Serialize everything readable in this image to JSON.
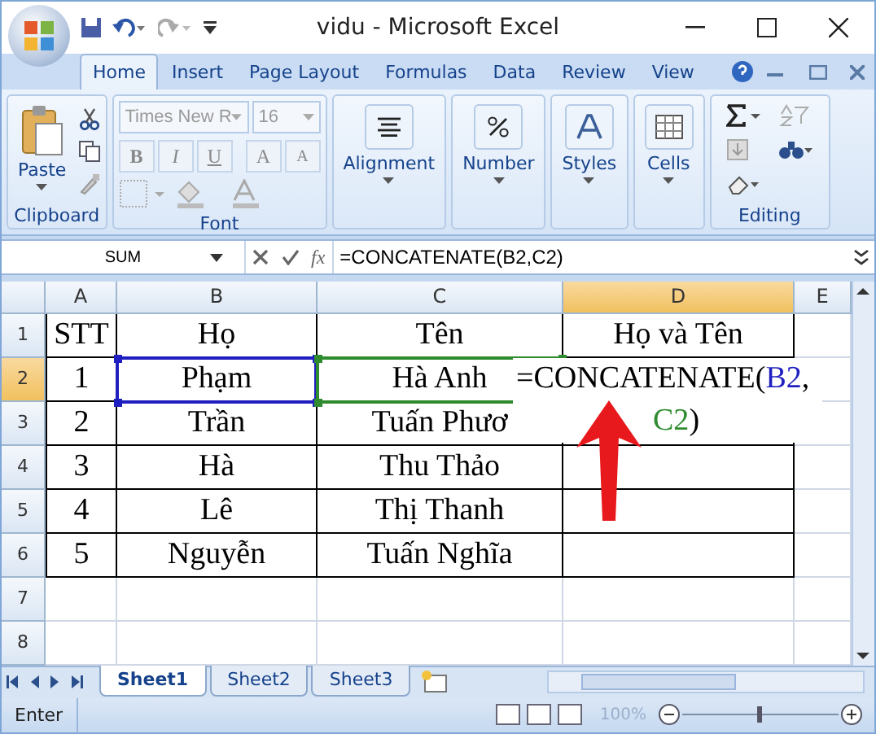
{
  "window": {
    "title": "vidu - Microsoft Excel"
  },
  "tabs": [
    {
      "label": "Home",
      "selected": true
    },
    {
      "label": "Insert",
      "selected": false
    },
    {
      "label": "Page Layout",
      "selected": false
    },
    {
      "label": "Formulas",
      "selected": false
    },
    {
      "label": "Data",
      "selected": false
    },
    {
      "label": "Review",
      "selected": false
    },
    {
      "label": "View",
      "selected": false
    }
  ],
  "ribbon": {
    "groups": [
      {
        "kind": "clipboard",
        "label": "Clipboard",
        "button": "Paste"
      },
      {
        "kind": "font",
        "label": "Font",
        "font_name": "Times New R",
        "font_size": "16",
        "buttons": [
          "B",
          "I",
          "U",
          "A",
          "A"
        ]
      },
      {
        "kind": "big",
        "button": "Alignment"
      },
      {
        "kind": "big",
        "button": "Number"
      },
      {
        "kind": "big",
        "button": "Styles"
      },
      {
        "kind": "big",
        "button": "Cells"
      },
      {
        "kind": "editing",
        "label": "Editing"
      }
    ]
  },
  "formula_bar": {
    "name_box": "SUM",
    "fx_button": "fx",
    "formula": "=CONCATENATE(B2,C2)"
  },
  "columns": [
    {
      "label": "A",
      "selected": false
    },
    {
      "label": "B",
      "selected": false
    },
    {
      "label": "C",
      "selected": false
    },
    {
      "label": "D",
      "selected": true
    },
    {
      "label": "E",
      "selected": false
    }
  ],
  "rows": [
    {
      "label": "1",
      "selected": false,
      "cells": [
        {
          "text": "STT"
        },
        {
          "text": "Họ"
        },
        {
          "text": "Tên"
        },
        {
          "text": "Họ và Tên"
        }
      ]
    },
    {
      "label": "2",
      "selected": true,
      "cells": [
        {
          "text": "1"
        },
        {
          "text": "Phạm",
          "color": "#1f1fbf"
        },
        {
          "text": "Hà Anh",
          "color": "#2e8b2e"
        },
        {}
      ]
    },
    {
      "label": "3",
      "selected": false,
      "cells": [
        {
          "text": "2"
        },
        {
          "text": "Trần"
        },
        {
          "text": "Tuấn Phươ"
        },
        {}
      ]
    },
    {
      "label": "4",
      "selected": false,
      "cells": [
        {
          "text": "3"
        },
        {
          "text": "Hà"
        },
        {
          "text": "Thu Thảo"
        },
        {}
      ]
    },
    {
      "label": "5",
      "selected": false,
      "cells": [
        {
          "text": "4"
        },
        {
          "text": "Lê"
        },
        {
          "text": "Thị Thanh"
        },
        {}
      ]
    },
    {
      "label": "6",
      "selected": false,
      "cells": [
        {
          "text": "5"
        },
        {
          "text": "Nguyễn"
        },
        {
          "text": "Tuấn Nghĩa"
        },
        {}
      ]
    },
    {
      "label": "7",
      "selected": false,
      "cells": []
    },
    {
      "label": "8",
      "selected": false,
      "cells": []
    }
  ],
  "cell_edit": {
    "lines": [
      [
        {
          "text": "=CONCATENATE(",
          "color": "#000000"
        },
        {
          "text": "B2",
          "color": "#1f1fbf"
        },
        {
          "text": ",",
          "color": "#000000"
        }
      ],
      [
        {
          "text": "C2",
          "color": "#2e8b2e"
        },
        {
          "text": ")",
          "color": "#000000"
        }
      ]
    ]
  },
  "sheet_tabs": [
    {
      "label": "Sheet1",
      "selected": true
    },
    {
      "label": "Sheet2",
      "selected": false
    },
    {
      "label": "Sheet3",
      "selected": false
    }
  ],
  "status_bar": {
    "mode": "Enter",
    "zoom": "100%"
  }
}
